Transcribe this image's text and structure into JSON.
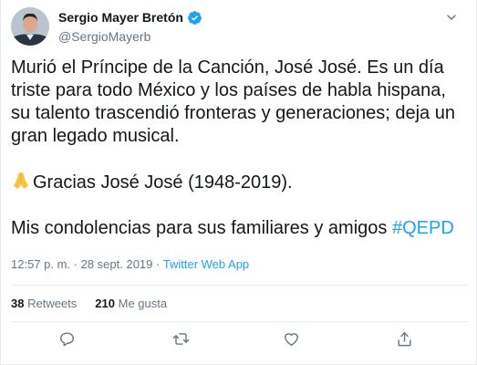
{
  "author": {
    "display_name": "Sergio Mayer Bretón",
    "handle": "@SergioMayerb",
    "verified": true
  },
  "tweet": {
    "line1": "Murió el Príncipe de la Canción, José José. Es un día",
    "line2": "triste para todo México y los países de habla hispana,",
    "line3": "su talento trascendió fronteras y generaciones; deja un",
    "line4": "gran legado musical.",
    "thanks": "Gracias José José (1948-2019).",
    "condolences": "Mis condolencias para sus familiares y amigos ",
    "hashtag": "#QEPD"
  },
  "meta": {
    "time": "12:57 p. m.",
    "separator": " · ",
    "date": "28 sept. 2019",
    "source": "Twitter Web App"
  },
  "stats": {
    "retweets_count": "38",
    "retweets_label": "Retweets",
    "likes_count": "210",
    "likes_label": "Me gusta"
  },
  "icons": {
    "verified": "verified-badge-icon",
    "menu": "chevron-down-icon",
    "reply": "reply-icon",
    "retweet": "retweet-icon",
    "like": "heart-icon",
    "share": "share-icon",
    "emoji": "folded-hands-icon"
  },
  "colors": {
    "accent": "#1da1f2",
    "text": "#14171a",
    "secondary": "#657786",
    "border": "#e6ecf0"
  }
}
